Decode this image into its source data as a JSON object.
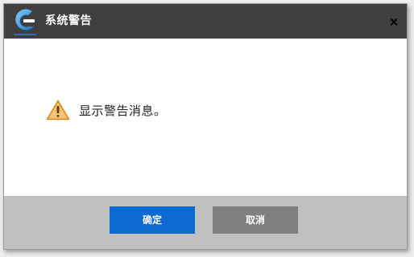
{
  "dialog": {
    "title": "系统警告",
    "close_label": "×",
    "logo_icon": "app-logo-icon",
    "message": "显示警告消息。",
    "message_icon": "warning-icon",
    "buttons": {
      "ok_label": "确定",
      "cancel_label": "取消"
    }
  },
  "colors": {
    "titlebar": "#3f3f3f",
    "ok_button": "#0a6ad2",
    "cancel_button": "#808080",
    "footer": "#c0c0c0",
    "warning": "#f0a030"
  }
}
